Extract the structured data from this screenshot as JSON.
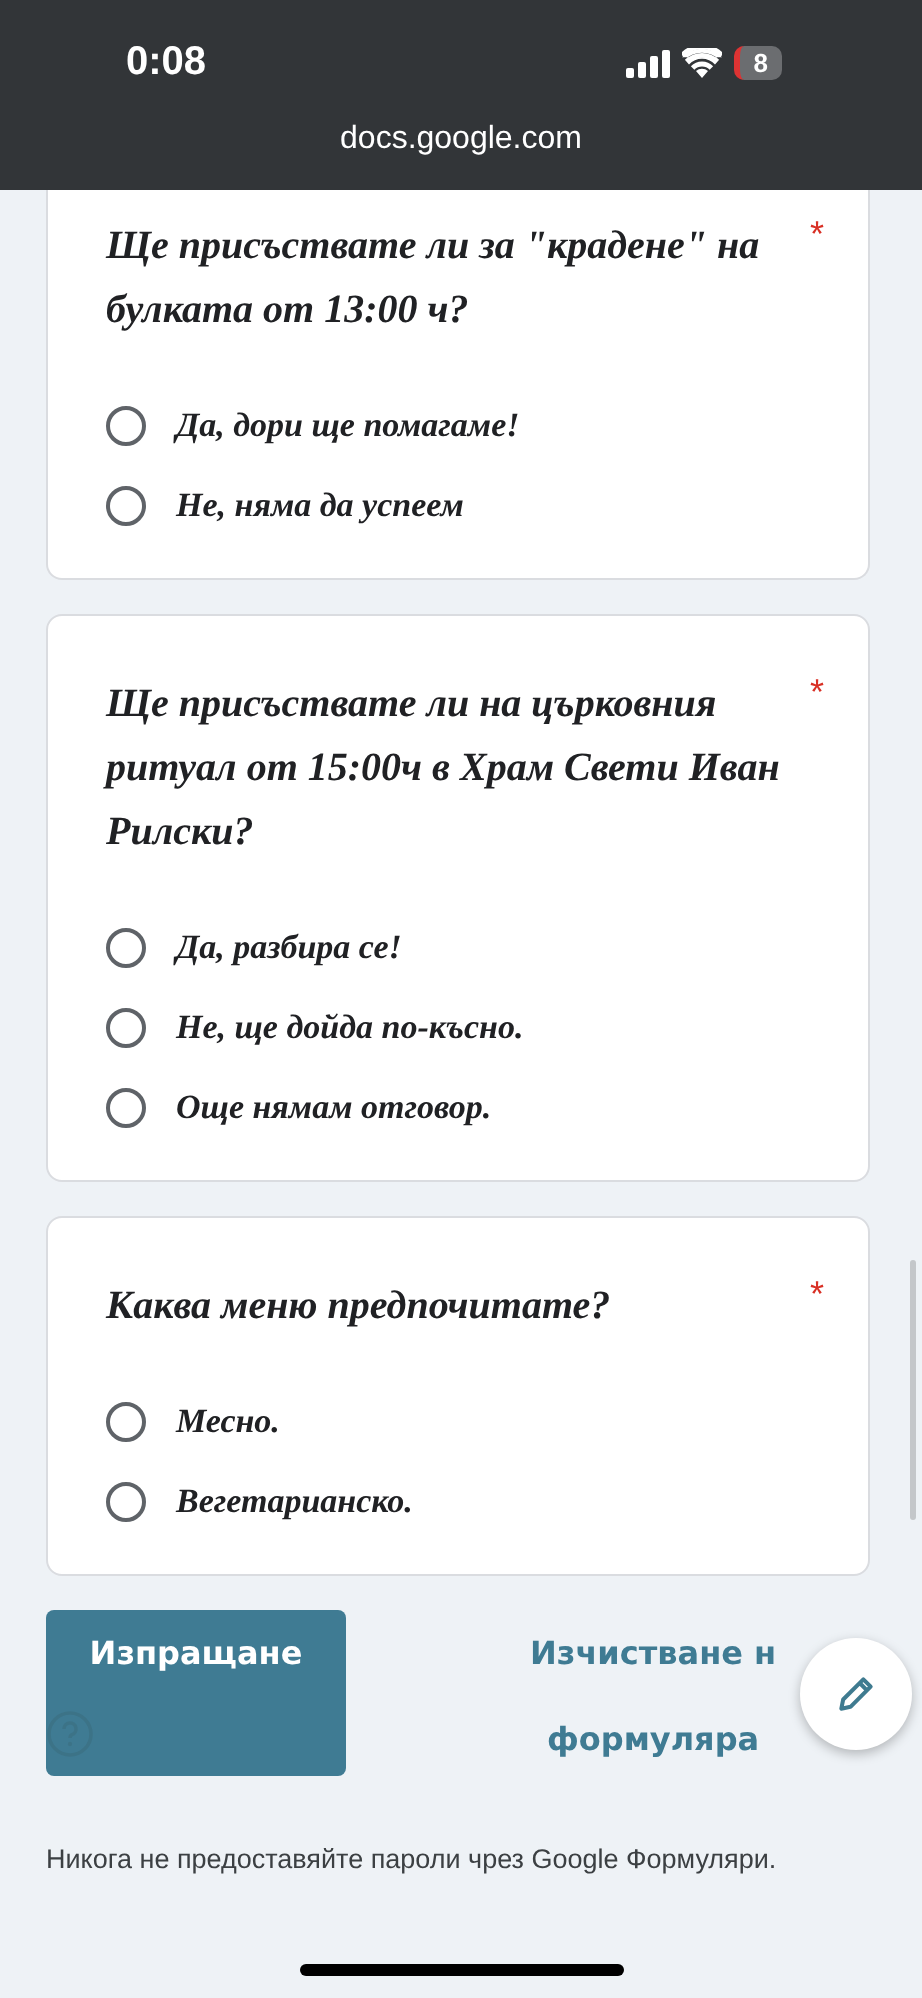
{
  "status_bar": {
    "time": "0:08",
    "battery": "8",
    "url": "docs.google.com"
  },
  "questions": [
    {
      "title": "Ще присъствате ли за \"крадене\" на булката от 13:00 ч?",
      "required_mark": "*",
      "options": [
        {
          "label": "Да, дори ще помагаме!",
          "selected": false
        },
        {
          "label": "Не, няма да успеем",
          "selected": false
        }
      ]
    },
    {
      "title": "Ще присъствате ли на църковния ритуал от 15:00ч в Храм Свети Иван Рилски?",
      "required_mark": "*",
      "options": [
        {
          "label": "Да, разбира се!",
          "selected": false
        },
        {
          "label": "Не, ще дойда по-късно.",
          "selected": false
        },
        {
          "label": "Още нямам отговор.",
          "selected": false
        }
      ]
    },
    {
      "title": "Каква меню предпочитате?",
      "required_mark": "*",
      "options": [
        {
          "label": "Месно.",
          "selected": false
        },
        {
          "label": "Вегетарианско.",
          "selected": false
        }
      ]
    }
  ],
  "submit_button": "Изпращане",
  "clear_button": {
    "lines": [
      "Изчистване н",
      "формуляра"
    ]
  },
  "footer": "Никога не предоставяйте пароли чрез Google Формуляри."
}
